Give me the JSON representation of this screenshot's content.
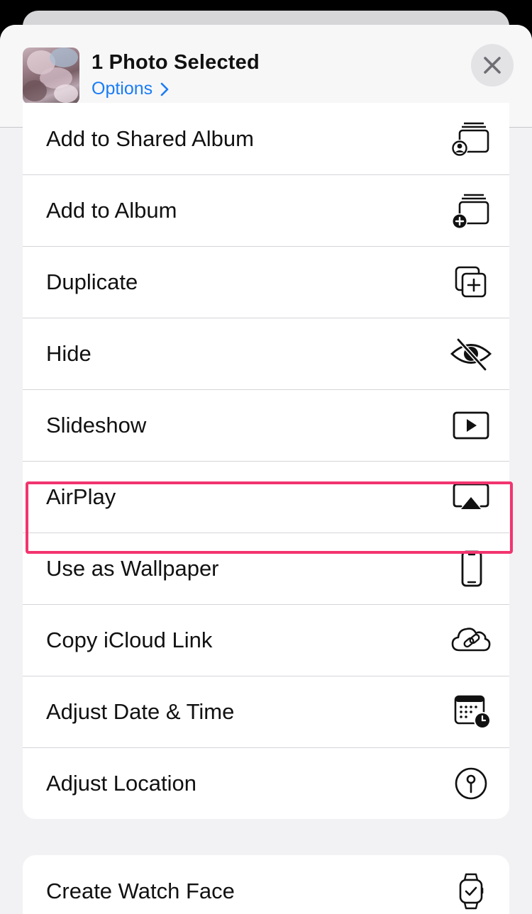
{
  "header": {
    "title": "1 Photo Selected",
    "options_label": "Options",
    "thumbnail": "cherry-blossom-photo",
    "close_icon": "close-icon"
  },
  "actions": [
    {
      "label": "Add to Shared Album",
      "icon": "shared-album-icon"
    },
    {
      "label": "Add to Album",
      "icon": "add-album-icon"
    },
    {
      "label": "Duplicate",
      "icon": "duplicate-icon"
    },
    {
      "label": "Hide",
      "icon": "eye-slash-icon"
    },
    {
      "label": "Slideshow",
      "icon": "play-rectangle-icon"
    },
    {
      "label": "AirPlay",
      "icon": "airplay-icon",
      "highlighted": true
    },
    {
      "label": "Use as Wallpaper",
      "icon": "iphone-icon"
    },
    {
      "label": "Copy iCloud Link",
      "icon": "cloud-link-icon"
    },
    {
      "label": "Adjust Date & Time",
      "icon": "calendar-clock-icon"
    },
    {
      "label": "Adjust Location",
      "icon": "location-pin-circle-icon"
    }
  ],
  "actions2": [
    {
      "label": "Create Watch Face",
      "icon": "watch-icon"
    }
  ],
  "colors": {
    "accent": "#1a7cf5",
    "highlight": "#f2346f",
    "sheet_background": "#f2f2f4"
  }
}
